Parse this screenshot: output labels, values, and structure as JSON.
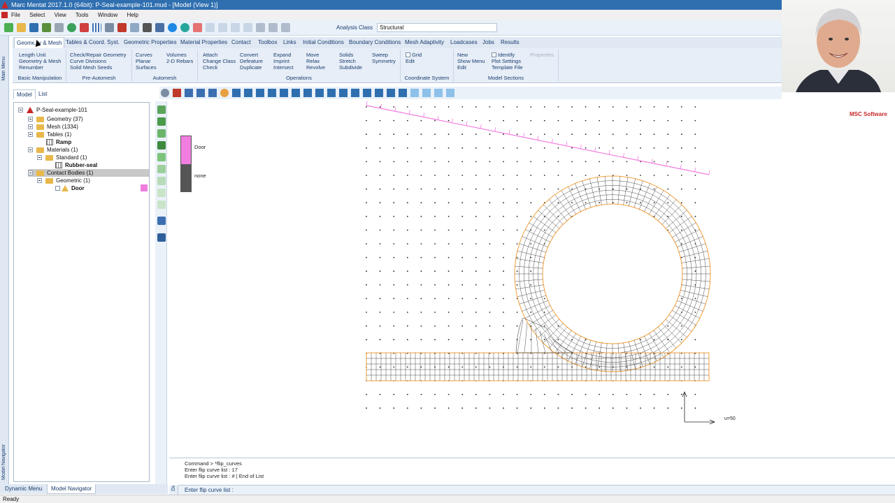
{
  "window": {
    "title": "Marc Mentat 2017.1.0 (64bit): P-Seal-example-101.mud - [Model (View 1)]"
  },
  "menu": [
    "File",
    "Select",
    "View",
    "Tools",
    "Window",
    "Help"
  ],
  "analysis": {
    "label": "Analysis Class",
    "value": "Structural"
  },
  "ribbon_tabs": [
    "Geometry & Mesh",
    "Tables & Coord. Syst.",
    "Geometric Properties",
    "Material Properties",
    "Contact",
    "Toolbox",
    "Links",
    "Initial Conditions",
    "Boundary Conditions",
    "Mesh Adaptivity",
    "Loadcases",
    "Jobs",
    "Results"
  ],
  "ribbon": {
    "basic": {
      "name": "Basic Manipulation",
      "items": [
        "Length Unit",
        "Geometry & Mesh",
        "Renumber"
      ]
    },
    "premesh": {
      "name": "Pre-Automesh",
      "items": [
        "Check/Repair Geometry",
        "Curve Divisions",
        "Solid Mesh Seeds"
      ]
    },
    "automesh": {
      "name": "Automesh",
      "col1": [
        "Curves",
        "Planar",
        "Surfaces"
      ],
      "col2": [
        "Volumes",
        "2-D Rebars"
      ]
    },
    "operations": {
      "name": "Operations",
      "col1": [
        "Attach",
        "Change Class",
        "Check"
      ],
      "col2": [
        "Convert",
        "Defeature",
        "Duplicate"
      ],
      "col3": [
        "Expand",
        "Imprint",
        "Intersect"
      ],
      "col4": [
        "Move",
        "Relax",
        "Revolve"
      ],
      "col5": [
        "Solids",
        "Stretch",
        "Subdivide"
      ],
      "col6": [
        "Sweep",
        "Symmetry"
      ]
    },
    "coord": {
      "name": "Coordinate System",
      "grid": "Grid",
      "edit": "Edit"
    },
    "sections": {
      "name": "Model Sections",
      "col1": [
        "New",
        "Show Menu",
        "Edit"
      ],
      "col2": [
        "Identify",
        "Plot Settings",
        "Template File"
      ],
      "col3": [
        "Properties"
      ]
    }
  },
  "side_labels": {
    "main_menu": "Main Menu",
    "model_navigator": "Model Navigator",
    "dialog": "Dialog"
  },
  "panel_tabs": [
    "Model",
    "List"
  ],
  "tree": {
    "root": "P-Seal-example-101",
    "geometry": "Geometry (37)",
    "mesh": "Mesh (1334)",
    "tables": "Tables (1)",
    "ramp": "Ramp",
    "materials": "Materials (1)",
    "standard": "Standard (1)",
    "rubber": "Rubber-seal",
    "contact": "Contact Bodies (1)",
    "geometric": "Geometric (1)",
    "door": "Door"
  },
  "legend": {
    "door": "Door",
    "none": "none"
  },
  "colors": {
    "door": "#f27de0",
    "none": "#555555",
    "mesh": "#222222",
    "outline": "#f2a03d"
  },
  "viewport": {
    "axis_label": "u=50"
  },
  "brand": "MSC Software",
  "console": [
    "Command > *flip_curves",
    "Enter flip curve list :  17",
    "Enter flip curve list : # | End of List"
  ],
  "command_prompt": "Enter flip curve list :",
  "bottom_tabs": [
    "Dynamic Menu",
    "Model Navigator"
  ],
  "status": "Ready"
}
